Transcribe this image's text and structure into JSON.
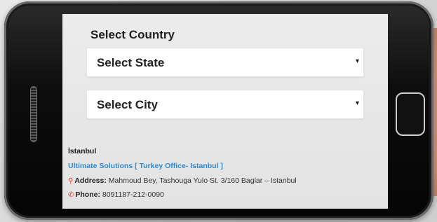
{
  "form": {
    "title": "Select Country",
    "state_select": {
      "label": "Select State",
      "caret": "▾"
    },
    "city_select": {
      "label": "Select City",
      "caret": "▾"
    }
  },
  "office": {
    "city": "İstanbul",
    "company": "Ultimate Solutions [ Turkey Office- Istanbul ]",
    "address_label": "Address:",
    "address": "Mahmoud Bey, Tashouga Yulo St. 3/160 Baglar – Istanbul",
    "phone_label": "Phone:",
    "phone": "8091187-212-0090"
  },
  "icons": {
    "address": "map-marker-icon",
    "phone": "phone-icon"
  },
  "colors": {
    "link": "#2a8ad2",
    "icon": "#e23b3b"
  }
}
